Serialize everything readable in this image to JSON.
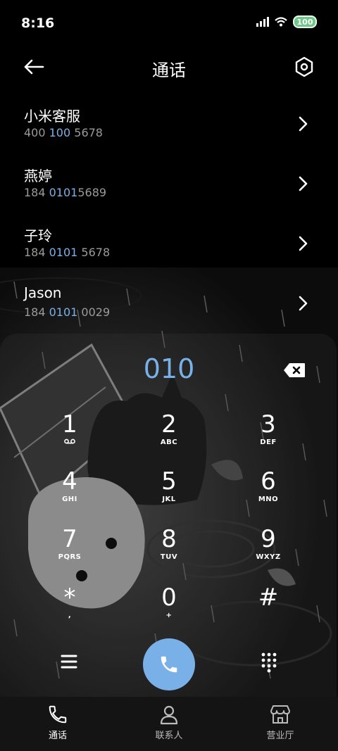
{
  "status_bar": {
    "time": "8:16",
    "battery": "100"
  },
  "header": {
    "title": "通话",
    "back_icon": "arrow-left-icon",
    "settings_icon": "settings-hexagon-icon"
  },
  "contacts": [
    {
      "name": "小米客服",
      "number_parts": [
        "400 ",
        "100",
        " 5678"
      ]
    },
    {
      "name": "燕婷",
      "number_parts": [
        "184 ",
        "0101",
        "5689"
      ]
    },
    {
      "name": "子玲",
      "number_parts": [
        "184 ",
        "0101",
        " 5678"
      ]
    },
    {
      "name": "Jason",
      "number_parts": [
        "184 ",
        "0101",
        " 0029"
      ]
    }
  ],
  "dialer": {
    "input": "010",
    "keys": [
      {
        "digit": "1",
        "letters": ""
      },
      {
        "digit": "2",
        "letters": "ABC"
      },
      {
        "digit": "3",
        "letters": "DEF"
      },
      {
        "digit": "4",
        "letters": "GHI"
      },
      {
        "digit": "5",
        "letters": "JKL"
      },
      {
        "digit": "6",
        "letters": "MNO"
      },
      {
        "digit": "7",
        "letters": "PQRS"
      },
      {
        "digit": "8",
        "letters": "TUV"
      },
      {
        "digit": "9",
        "letters": "WXYZ"
      },
      {
        "digit": "*",
        "letters": ","
      },
      {
        "digit": "0",
        "letters": "+"
      },
      {
        "digit": "#",
        "letters": ""
      }
    ]
  },
  "bottom_nav": [
    {
      "label": "通话",
      "icon": "phone-icon",
      "active": true
    },
    {
      "label": "联系人",
      "icon": "person-icon",
      "active": false
    },
    {
      "label": "营业厅",
      "icon": "store-icon",
      "active": false
    }
  ],
  "colors": {
    "accent": "#7ab0e8",
    "secondary_text": "#9a9a9a",
    "background": "#000000"
  }
}
